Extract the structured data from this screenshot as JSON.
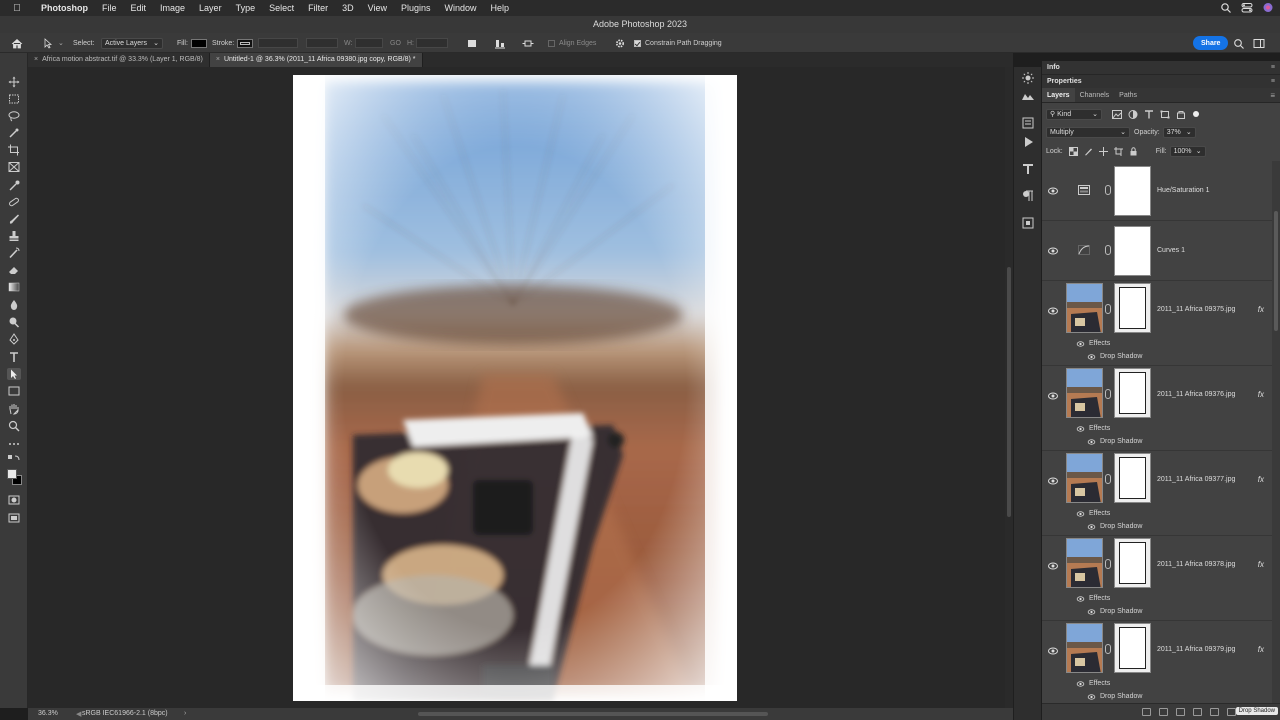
{
  "menubar": {
    "items": [
      "Photoshop",
      "File",
      "Edit",
      "Image",
      "Layer",
      "Type",
      "Select",
      "Filter",
      "3D",
      "View",
      "Plugins",
      "Window",
      "Help"
    ]
  },
  "window": {
    "title": "Adobe Photoshop 2023"
  },
  "options_bar": {
    "select_label": "Select:",
    "select_value": "Active Layers",
    "fill_label": "Fill:",
    "stroke_label": "Stroke:",
    "w_label": "W:",
    "go_label": "GO",
    "h_label": "H:",
    "align_edges": "Align Edges",
    "constrain_label": "Constrain Path Dragging",
    "share": "Share"
  },
  "doc_tabs": [
    {
      "label": "Africa motion abstract.tif @ 33.3% (Layer 1, RGB/8)",
      "active": false
    },
    {
      "label": "Untitled-1 @ 36.3% (2011_11 Africa 09380.jpg copy, RGB/8) *",
      "active": true
    }
  ],
  "status": {
    "zoom": "36.3%",
    "profile": "sRGB IEC61966-2.1 (8bpc)"
  },
  "panels": {
    "info": "Info",
    "properties": "Properties",
    "tabs": [
      "Layers",
      "Channels",
      "Paths"
    ],
    "filter_kind": "Kind",
    "blend_mode": "Multiply",
    "opacity_label": "Opacity:",
    "opacity_value": "37%",
    "lock_label": "Lock:",
    "fill_label": "Fill:",
    "fill_value": "100%",
    "tooltip": "Drop Shadow"
  },
  "layers": [
    {
      "name": "Hue/Saturation 1",
      "kind": "adjustment"
    },
    {
      "name": "Curves 1",
      "kind": "adjustment"
    },
    {
      "name": "2011_11 Africa 09375.jpg",
      "kind": "photo",
      "effects": "Effects",
      "effect": "Drop Shadow",
      "fx": "fx"
    },
    {
      "name": "2011_11 Africa 09376.jpg",
      "kind": "photo",
      "effects": "Effects",
      "effect": "Drop Shadow",
      "fx": "fx"
    },
    {
      "name": "2011_11 Africa 09377.jpg",
      "kind": "photo",
      "effects": "Effects",
      "effect": "Drop Shadow",
      "fx": "fx"
    },
    {
      "name": "2011_11 Africa 09378.jpg",
      "kind": "photo",
      "effects": "Effects",
      "effect": "Drop Shadow",
      "fx": "fx"
    },
    {
      "name": "2011_11 Africa 09379.jpg",
      "kind": "photo",
      "effects": "Effects",
      "effect": "Drop Shadow",
      "fx": "fx"
    }
  ],
  "colors": {
    "accent": "#1473e6",
    "panel": "#424242",
    "canvas": "#282828"
  }
}
